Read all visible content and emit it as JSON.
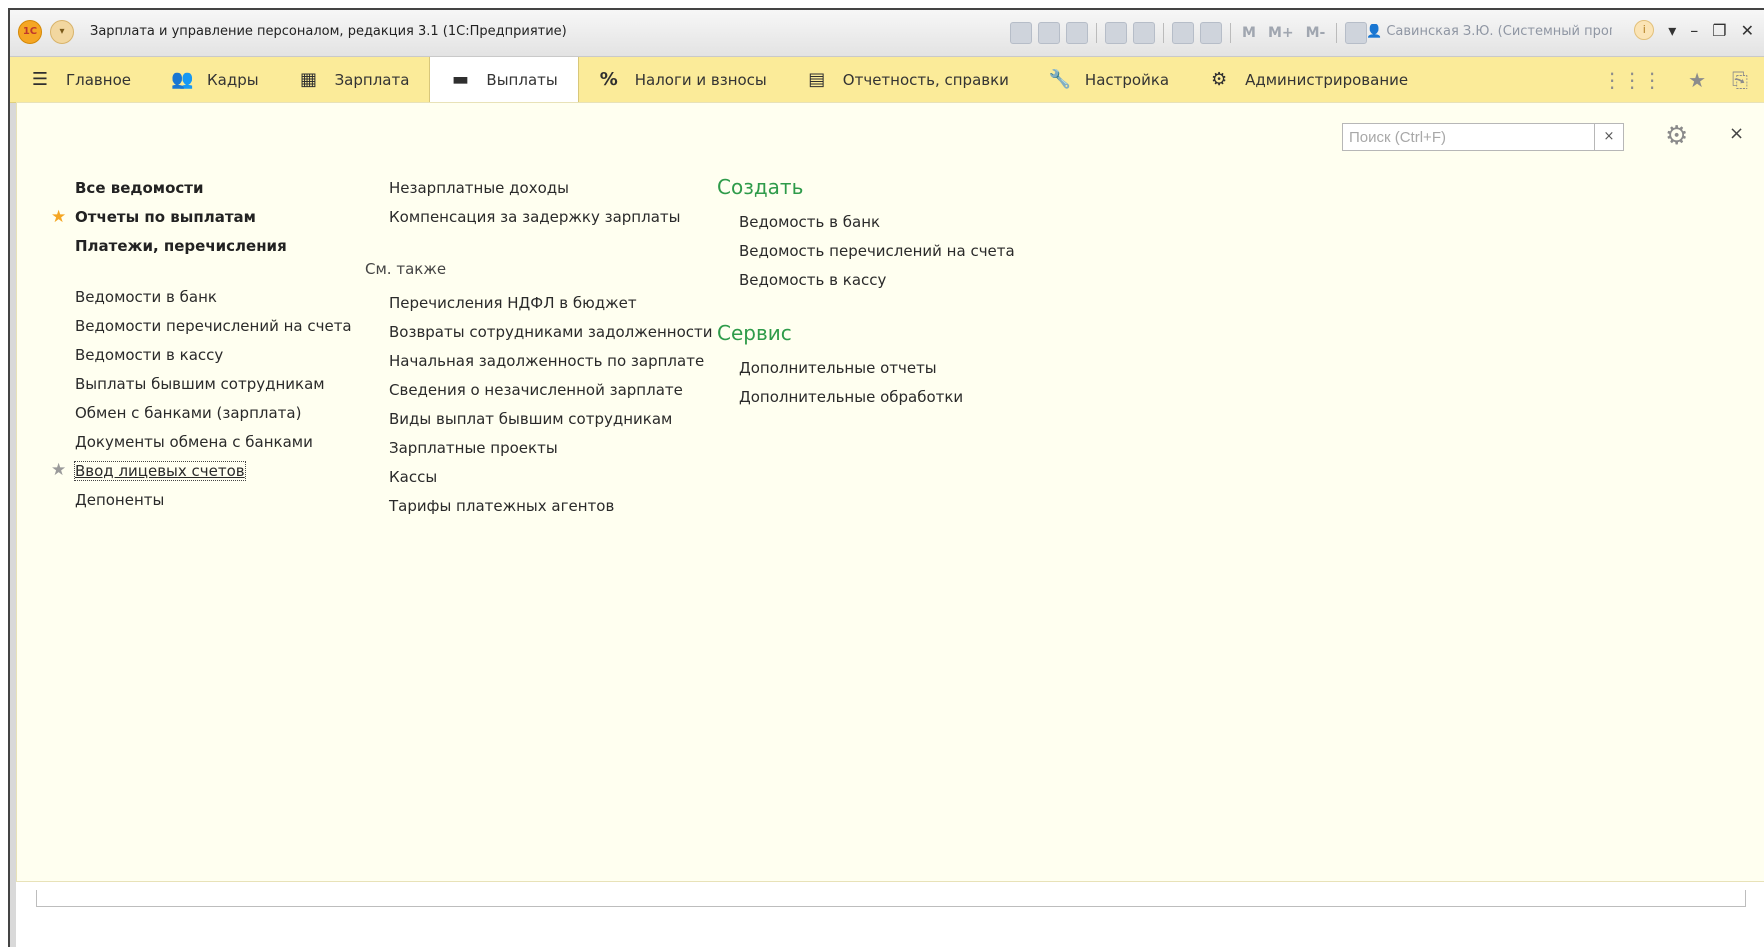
{
  "window": {
    "title": "Зарплата и управление персоналом, редакция 3.1  (1С:Предприятие)",
    "user": "Савинская З.Ю. (Системный прог...",
    "m_buttons": [
      "M",
      "M+",
      "M-"
    ]
  },
  "sections": [
    {
      "label": "Главное",
      "icon": "≡",
      "icon_name": "hamburger-icon"
    },
    {
      "label": "Кадры",
      "icon": "👥",
      "icon_name": "people-icon"
    },
    {
      "label": "Зарплата",
      "icon": "▦",
      "icon_name": "calculator-icon"
    },
    {
      "label": "Выплаты",
      "icon": "▬",
      "icon_name": "card-icon",
      "active": true
    },
    {
      "label": "Налоги и взносы",
      "icon": "%",
      "icon_name": "percent-icon"
    },
    {
      "label": "Отчетность, справки",
      "icon": "▤",
      "icon_name": "report-icon"
    },
    {
      "label": "Настройка",
      "icon": "🔧",
      "icon_name": "wrench-icon"
    },
    {
      "label": "Администрирование",
      "icon": "⚙",
      "icon_name": "gear-icon"
    }
  ],
  "search": {
    "placeholder": "Поиск (Ctrl+F)",
    "clear": "×"
  },
  "close_label": "×",
  "col1": {
    "bold_links": [
      "Все ведомости",
      "Отчеты по выплатам",
      "Платежи, перечисления"
    ],
    "links": [
      "Ведомости в банк",
      "Ведомости перечислений на счета",
      "Ведомости в кассу",
      "Выплаты бывшим сотрудникам",
      "Обмен с банками (зарплата)",
      "Документы обмена с банками",
      "Ввод лицевых счетов",
      "Депоненты"
    ]
  },
  "col2": {
    "links_top": [
      "Незарплатные доходы",
      "Компенсация за задержку зарплаты"
    ],
    "see_also": "См. также",
    "links": [
      "Перечисления НДФЛ в бюджет",
      "Возвраты сотрудниками задолженности",
      "Начальная задолженность по зарплате",
      "Сведения о незачисленной зарплате",
      "Виды выплат бывшим сотрудникам",
      "Зарплатные проекты",
      "Кассы",
      "Тарифы платежных агентов"
    ]
  },
  "col3": {
    "create_head": "Создать",
    "create_links": [
      "Ведомость в банк",
      "Ведомость перечислений на счета",
      "Ведомость в кассу"
    ],
    "service_head": "Сервис",
    "service_links": [
      "Дополнительные отчеты",
      "Дополнительные обработки"
    ]
  },
  "colors": {
    "section_bar": "#fbeb99",
    "panel_bg": "#fffff0",
    "green_head": "#2e9b4a",
    "star_gold": "#f5a623"
  }
}
